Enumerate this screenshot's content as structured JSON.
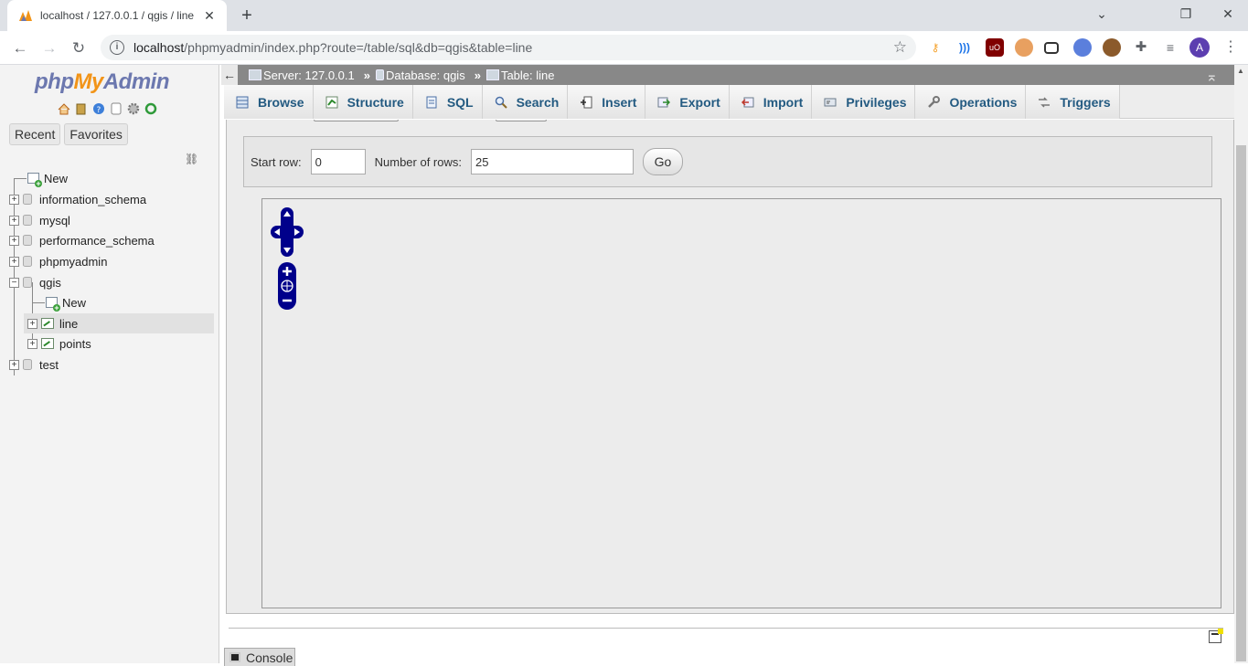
{
  "browser": {
    "tab_title": "localhost / 127.0.0.1 / qgis / line",
    "close_glyph": "✕",
    "new_tab_glyph": "+",
    "window_controls": {
      "minimize": "⌄",
      "restore": "❐",
      "close": "✕"
    },
    "nav": {
      "back": "←",
      "forward": "→",
      "reload": "↻"
    },
    "url_host": "localhost",
    "url_path": "/phpmyadmin/index.php?route=/table/sql&db=qgis&table=line",
    "info_glyph": "i",
    "star_glyph": "☆",
    "profile_initial": "A",
    "menu_glyph": "⋮"
  },
  "nav_panel": {
    "logo_php": "php",
    "logo_my": "My",
    "logo_admin": "Admin",
    "tab_recent": "Recent",
    "tab_favorites": "Favorites",
    "tree": {
      "new": "New",
      "information_schema": "information_schema",
      "mysql": "mysql",
      "performance_schema": "performance_schema",
      "phpmyadmin": "phpmyadmin",
      "qgis": "qgis",
      "qgis_new": "New",
      "line": "line",
      "points": "points",
      "test": "test"
    },
    "expand_plus": "+",
    "expand_minus": "−"
  },
  "breadcrumb": {
    "server": "Server: 127.0.0.1",
    "database": "Database: qgis",
    "table": "Table: line",
    "sep": "»",
    "collapse_left": "←",
    "collapse_top": "⌅"
  },
  "tabs": {
    "browse": "Browse",
    "structure": "Structure",
    "sql": "SQL",
    "search": "Search",
    "insert": "Insert",
    "export": "Export",
    "import": "Import",
    "privileges": "Privileges",
    "operations": "Operations",
    "triggers": "Triggers"
  },
  "form": {
    "start_row_label": "Start row:",
    "start_row_value": "0",
    "rows_label": "Number of rows:",
    "rows_value": "25",
    "go_label": "Go"
  },
  "console": {
    "label": "Console"
  },
  "colors": {
    "tab_text": "#235a81",
    "map_control": "#00008b",
    "logo_php": "#6c78af",
    "logo_my": "#f29418"
  }
}
